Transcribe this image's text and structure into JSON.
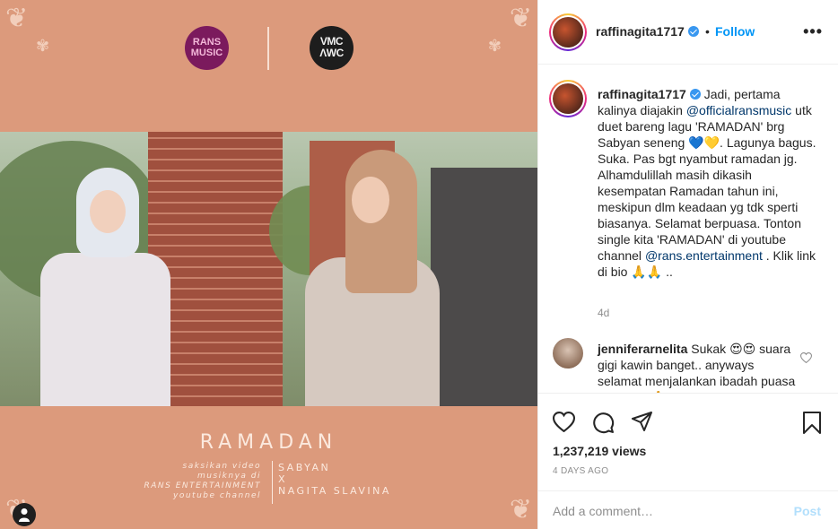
{
  "media": {
    "logo_left_lines": [
      "RANS",
      "MUSIC"
    ],
    "logo_right_lines": [
      "VMC",
      "ΛWC"
    ],
    "title": "RAMADAN",
    "sub_left": [
      "saksikan video",
      "musiknya di",
      "RANS ENTERTAINMENT",
      "youtube channel"
    ],
    "sub_right": [
      "SABYAN",
      "X",
      "NAGITA SLAVINA"
    ],
    "tag_icon": "person-icon",
    "colors": {
      "background": "#dc9a7c",
      "text": "#fbe9de"
    }
  },
  "header": {
    "username": "raffinagita1717",
    "separator": "•",
    "follow_label": "Follow",
    "more_label": "•••"
  },
  "caption": {
    "username": "raffinagita1717",
    "text_1": " Jadi, pertama kalinya diajakin ",
    "mention_1": "@officialransmusic",
    "text_2": " utk duet bareng lagu 'RAMADAN' brg Sabyan seneng 💙💛. Lagunya bagus. Suka. Pas bgt nyambut ramadan jg. Alhamdulillah masih dikasih kesempatan Ramadan tahun ini, meskipun dlm keadaan yg tdk sperti biasanya. Selamat berpuasa. Tonton single kita 'RAMADAN' di youtube channel ",
    "mention_2": "@rans.entertainment",
    "text_3": " . Klik link di bio 🙏🙏 ..",
    "time": "4d"
  },
  "comment": {
    "username": "jenniferarnelita",
    "text": " Sukak 😍😍 suara gigi kawin banget.. anyways selamat menjalankan ibadah puasa ya kalian 🙏",
    "heart_icon": "heart-outline-icon"
  },
  "actions": {
    "icons": [
      "heart-icon",
      "comment-icon",
      "share-icon",
      "bookmark-icon"
    ],
    "views": "1,237,219 views",
    "ago": "4 DAYS AGO",
    "comment_placeholder": "Add a comment…",
    "post_label": "Post"
  },
  "colors": {
    "link": "#00376b",
    "follow": "#0095f6",
    "verified": "#3897f0",
    "muted": "#8e8e8e",
    "post_disabled": "#b2dffc"
  }
}
